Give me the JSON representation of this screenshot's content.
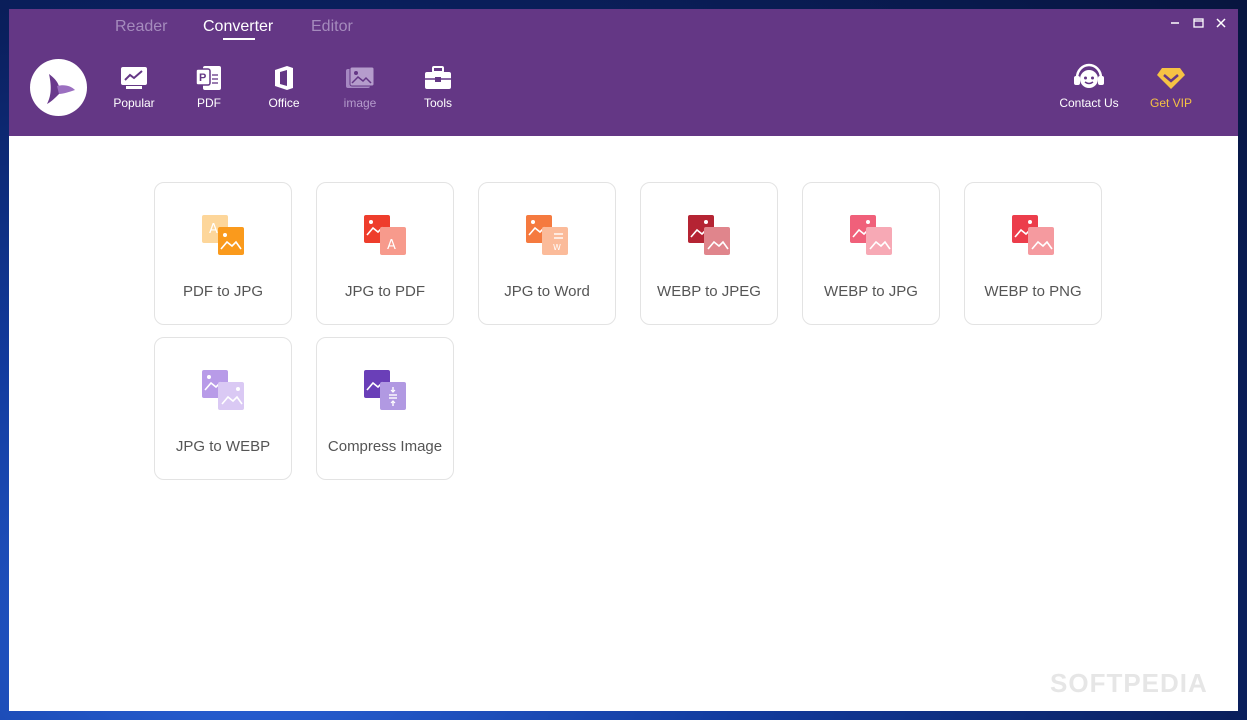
{
  "mode_tabs": [
    {
      "label": "Reader"
    },
    {
      "label": "Converter"
    },
    {
      "label": "Editor"
    }
  ],
  "categories": [
    {
      "label": "Popular",
      "icon": "chart-icon"
    },
    {
      "label": "PDF",
      "icon": "pdf-icon"
    },
    {
      "label": "Office",
      "icon": "office-icon"
    },
    {
      "label": "image",
      "icon": "image-icon"
    },
    {
      "label": "Tools",
      "icon": "toolbox-icon"
    }
  ],
  "header_right": {
    "contact_label": "Contact Us",
    "vip_label": "Get VIP"
  },
  "tools": [
    {
      "label": "PDF to JPG"
    },
    {
      "label": "JPG to PDF"
    },
    {
      "label": "JPG to Word"
    },
    {
      "label": "WEBP to JPEG"
    },
    {
      "label": "WEBP to JPG"
    },
    {
      "label": "WEBP to PNG"
    },
    {
      "label": "JPG to WEBP"
    },
    {
      "label": "Compress Image"
    }
  ],
  "watermark": "SOFTPEDIA",
  "colors": {
    "header": "#643785",
    "accent_vip": "#f6c244",
    "card_border": "#e3e3e3"
  }
}
